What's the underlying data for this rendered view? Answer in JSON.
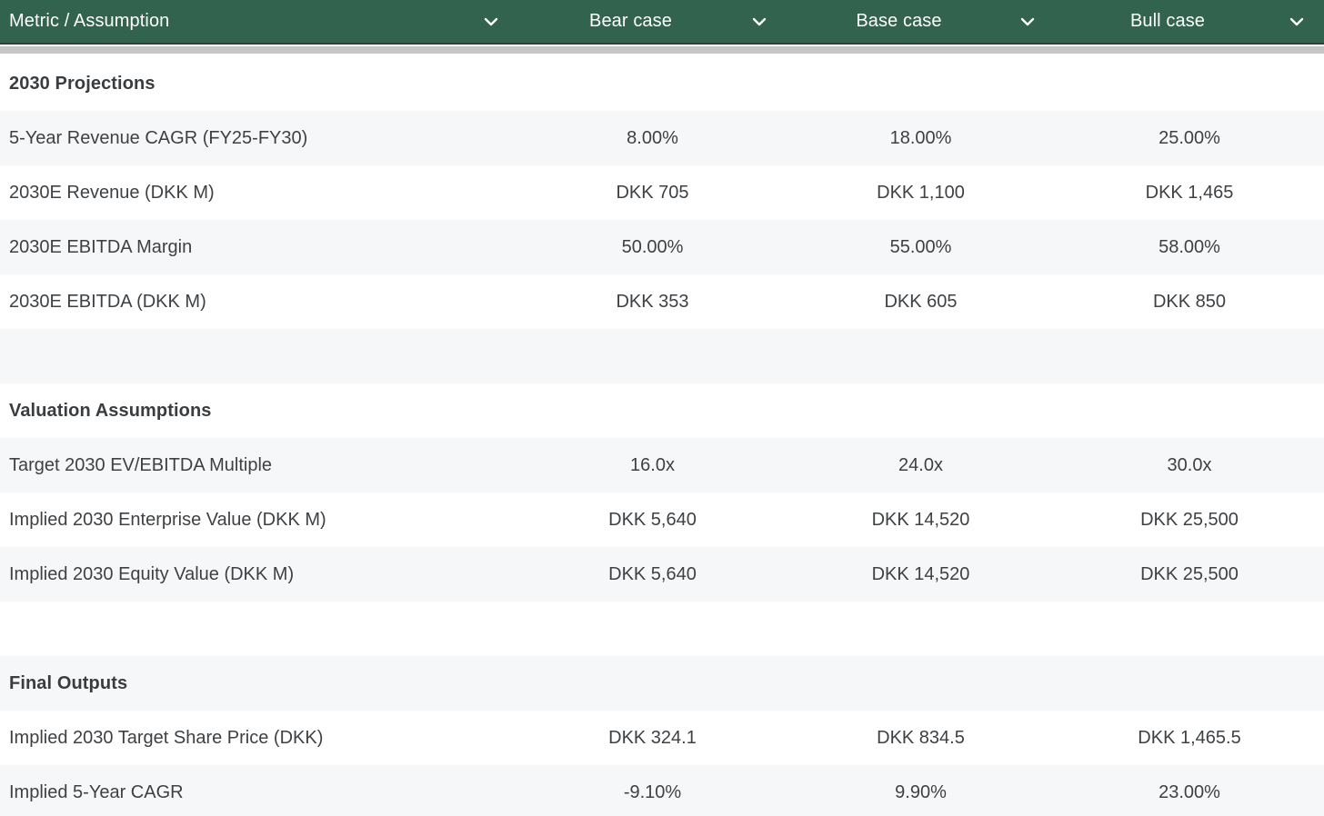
{
  "header": {
    "columns": [
      {
        "label": "Metric / Assumption"
      },
      {
        "label": "Bear case"
      },
      {
        "label": "Base case"
      },
      {
        "label": "Bull case"
      }
    ],
    "sort_icon": "chevron-down"
  },
  "colors": {
    "header_bg": "#31634F",
    "header_text": "#FFFFFF",
    "divider_gray": "#C6C6C6",
    "row_stripe": "#F6F7F8",
    "row_text": "#3E4144"
  },
  "rows": [
    {
      "type": "section",
      "label": "2030 Projections",
      "bear": "",
      "base": "",
      "bull": ""
    },
    {
      "type": "data",
      "label": "5-Year Revenue CAGR (FY25-FY30)",
      "bear": "8.00%",
      "base": "18.00%",
      "bull": "25.00%"
    },
    {
      "type": "data",
      "label": "2030E Revenue (DKK M)",
      "bear": "DKK 705",
      "base": "DKK 1,100",
      "bull": "DKK 1,465"
    },
    {
      "type": "data",
      "label": "2030E EBITDA Margin",
      "bear": "50.00%",
      "base": "55.00%",
      "bull": "58.00%"
    },
    {
      "type": "data",
      "label": "2030E EBITDA (DKK M)",
      "bear": "DKK 353",
      "base": "DKK 605",
      "bull": "DKK 850"
    },
    {
      "type": "empty",
      "label": "",
      "bear": "",
      "base": "",
      "bull": ""
    },
    {
      "type": "section",
      "label": "Valuation Assumptions",
      "bear": "",
      "base": "",
      "bull": ""
    },
    {
      "type": "data",
      "label": "Target 2030 EV/EBITDA Multiple",
      "bear": "16.0x",
      "base": "24.0x",
      "bull": "30.0x"
    },
    {
      "type": "data",
      "label": "Implied 2030 Enterprise Value (DKK M)",
      "bear": "DKK 5,640",
      "base": "DKK 14,520",
      "bull": "DKK 25,500"
    },
    {
      "type": "data",
      "label": "Implied 2030 Equity Value (DKK M)",
      "bear": "DKK 5,640",
      "base": "DKK 14,520",
      "bull": "DKK 25,500"
    },
    {
      "type": "empty",
      "label": "",
      "bear": "",
      "base": "",
      "bull": ""
    },
    {
      "type": "section",
      "label": "Final Outputs",
      "bear": "",
      "base": "",
      "bull": ""
    },
    {
      "type": "data",
      "label": "Implied 2030 Target Share Price (DKK)",
      "bear": "DKK 324.1",
      "base": "DKK 834.5",
      "bull": "DKK 1,465.5"
    },
    {
      "type": "data",
      "label": "Implied 5-Year CAGR",
      "bear": "-9.10%",
      "base": "9.90%",
      "bull": "23.00%"
    }
  ]
}
